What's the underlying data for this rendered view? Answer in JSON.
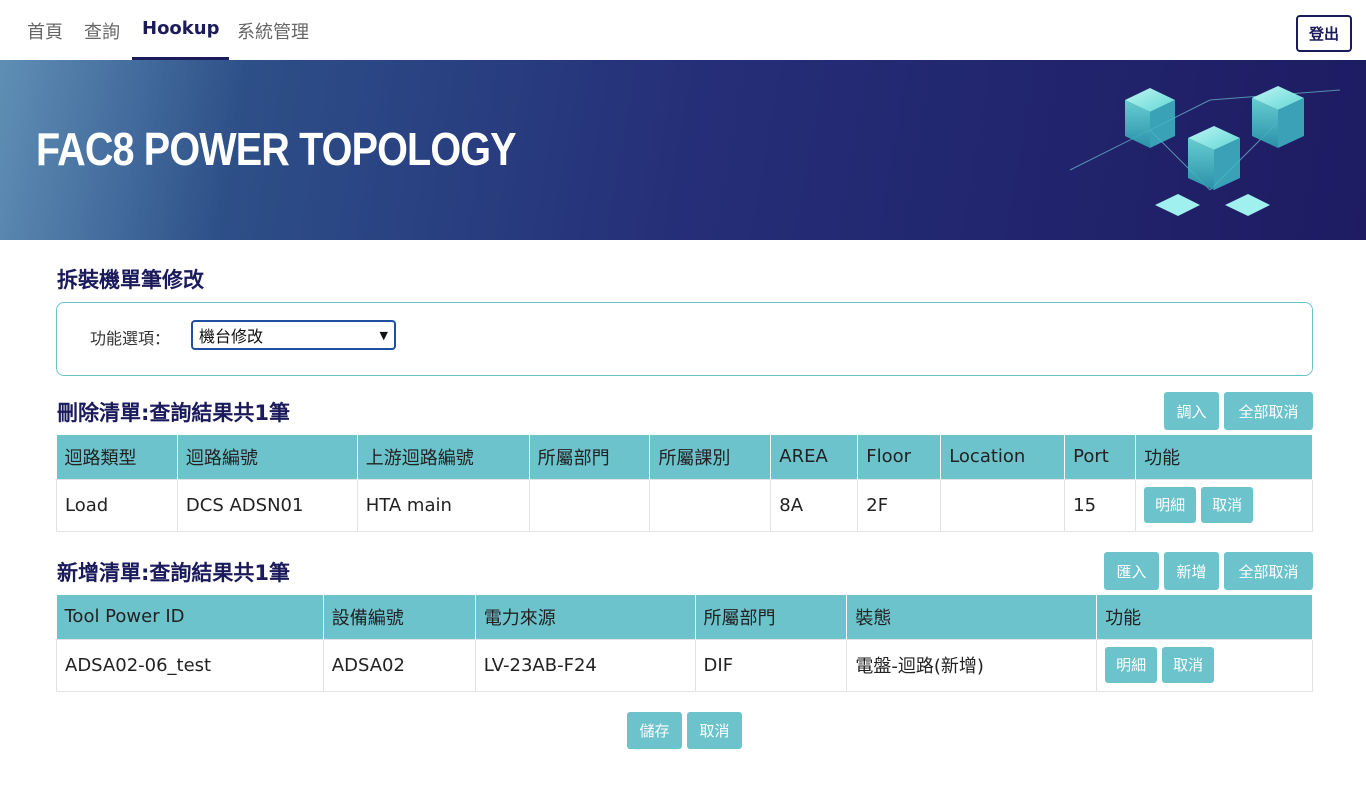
{
  "nav": {
    "home": "首頁",
    "query": "查詢",
    "hookup": "Hookup",
    "admin": "系統管理",
    "logout": "登出"
  },
  "banner": {
    "title": "FAC8 POWER TOPOLOGY"
  },
  "page": {
    "title": "拆裝機單筆修改",
    "function_label": "功能選項：",
    "function_value": "機台修改"
  },
  "delete_list": {
    "title": "刪除清單:查詢結果共1筆",
    "buttons": {
      "import": "調入",
      "cancel_all": "全部取消"
    },
    "columns": [
      "迴路類型",
      "迴路編號",
      "上游迴路編號",
      "所屬部門",
      "所屬課別",
      "AREA",
      "Floor",
      "Location",
      "Port",
      "功能"
    ],
    "rows": [
      {
        "type": "Load",
        "circuit": "DCS ADSN01",
        "upstream": "HTA main",
        "dept": "",
        "section": "",
        "area": "8A",
        "floor": "2F",
        "location": "",
        "port": "15",
        "detail": "明細",
        "cancel": "取消"
      }
    ]
  },
  "add_list": {
    "title": "新增清單:查詢結果共1筆",
    "buttons": {
      "import": "匯入",
      "add": "新增",
      "cancel_all": "全部取消"
    },
    "columns": [
      "Tool Power ID",
      "設備編號",
      "電力來源",
      "所屬部門",
      "裝態",
      "功能"
    ],
    "rows": [
      {
        "tool_power_id": "ADSA02-06_test",
        "equipment": "ADSA02",
        "power_source": "LV-23AB-F24",
        "dept": "DIF",
        "status": "電盤-迴路(新增)",
        "detail": "明細",
        "cancel": "取消"
      }
    ]
  },
  "footer": {
    "save": "儲存",
    "cancel": "取消"
  },
  "colors": {
    "accent": "#6cc3cc",
    "navy": "#1b1b5c",
    "select_border": "#1f4fa3"
  }
}
